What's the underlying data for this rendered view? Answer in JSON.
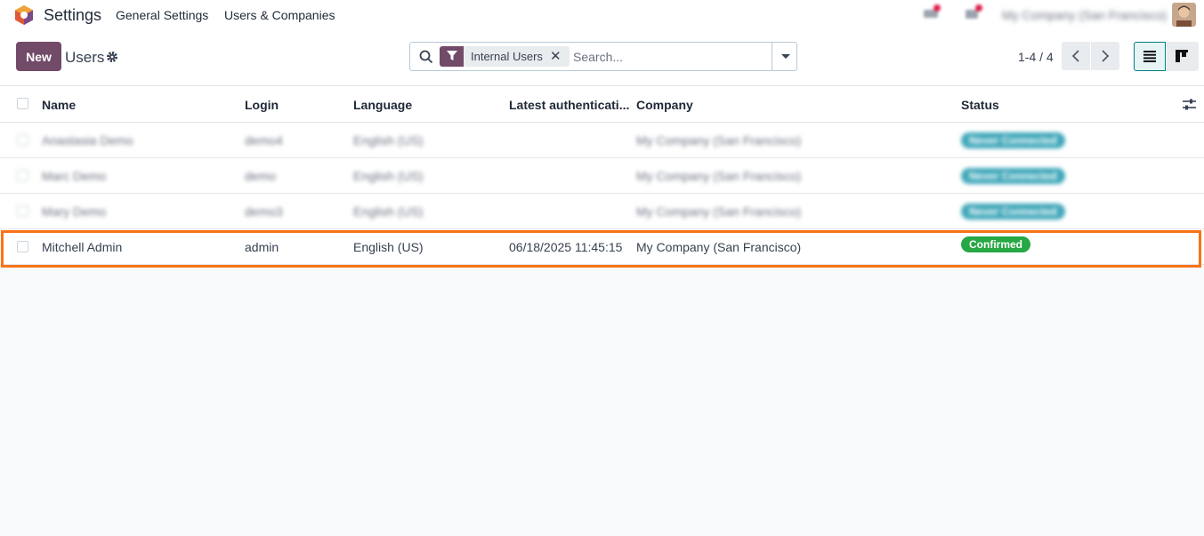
{
  "navbar": {
    "app_name": "Settings",
    "menus": [
      "General Settings",
      "Users & Companies"
    ],
    "company_switcher": "My Company (San Francisco)"
  },
  "control_panel": {
    "new_label": "New",
    "title": "Users",
    "search": {
      "facet_label": "Internal Users",
      "placeholder": "Search..."
    },
    "pager": "1-4 / 4"
  },
  "list": {
    "columns": [
      "Name",
      "Login",
      "Language",
      "Latest authenticati...",
      "Company",
      "Status"
    ],
    "rows": [
      {
        "name": "Anastasia Demo",
        "login": "demo4",
        "language": "English (US)",
        "latest_auth": "",
        "company": "My Company (San Francisco)",
        "status": "Never Connected",
        "status_kind": "info",
        "blurred": true
      },
      {
        "name": "Marc Demo",
        "login": "demo",
        "language": "English (US)",
        "latest_auth": "",
        "company": "My Company (San Francisco)",
        "status": "Never Connected",
        "status_kind": "info",
        "blurred": true
      },
      {
        "name": "Mary Demo",
        "login": "demo3",
        "language": "English (US)",
        "latest_auth": "",
        "company": "My Company (San Francisco)",
        "status": "Never Connected",
        "status_kind": "info",
        "blurred": true
      },
      {
        "name": "Mitchell Admin",
        "login": "admin",
        "language": "English (US)",
        "latest_auth": "06/18/2025 11:45:15",
        "company": "My Company (San Francisco)",
        "status": "Confirmed",
        "status_kind": "success",
        "blurred": false
      }
    ]
  },
  "colors": {
    "brand": "#714b67",
    "accent": "#017e84",
    "highlight": "#f97316",
    "badge_success": "#28a745",
    "badge_info": "#3fa7b9"
  },
  "icons": [
    "app-logo-icon",
    "gear-icon",
    "search-icon",
    "filter-icon",
    "close-icon",
    "chevron-down-icon",
    "chevron-left-icon",
    "chevron-right-icon",
    "list-view-icon",
    "kanban-view-icon",
    "sliders-icon"
  ]
}
